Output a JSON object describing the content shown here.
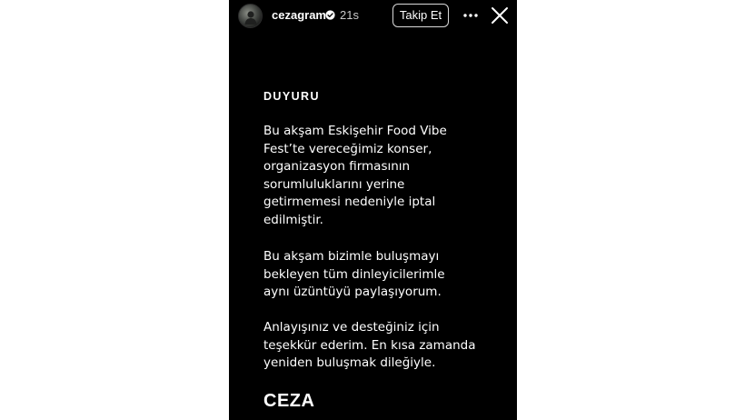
{
  "story": {
    "header": {
      "username": "cezagram",
      "time": "21s",
      "follow_label": "Takip Et"
    },
    "icons": {
      "avatar": "profile-avatar",
      "verified": "verified-badge-icon",
      "more": "more-options-icon",
      "close": "close-icon"
    },
    "announcement": {
      "heading": "DUYURU",
      "paragraphs": [
        "Bu akşam Eskişehir Food Vibe\nFest’te vereceğimiz konser,\norganizasyon firmasının\nsorumluluklarını yerine\ngetirmemesi nedeniyle iptal\nedilmiştir.",
        "Bu akşam bizimle buluşmayı\nbekleyen tüm dinleyicilerimle\naynı üzüntüyü paylaşıyorum.",
        "Anlayışınız ve desteğiniz için\nteşekkür ederim. En kısa zamanda\nyeniden buluşmak dileğiyle."
      ],
      "signature": "CEZA"
    },
    "colors": {
      "background": "#000000",
      "text": "#ffffff",
      "muted_text": "#c9c9c9",
      "button_border": "#d9d9d9"
    }
  }
}
